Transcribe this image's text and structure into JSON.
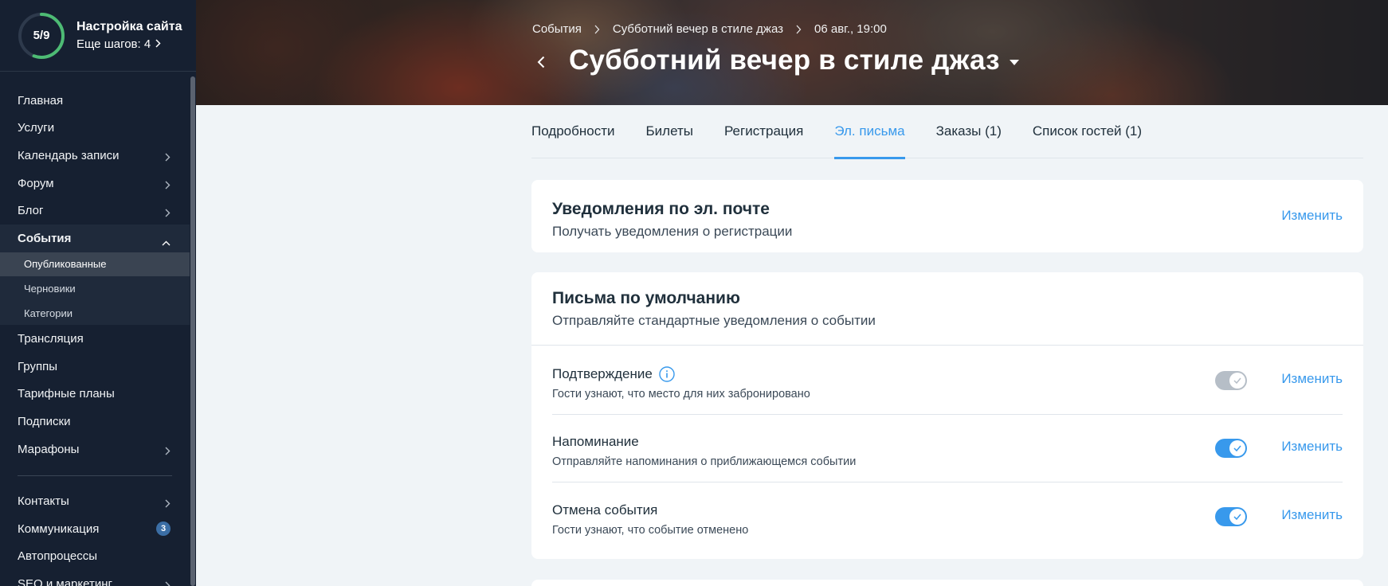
{
  "setup": {
    "progress_text": "5/9",
    "progress": 0.556,
    "title": "Настройка сайта",
    "subtitle": "Еще шагов: 4"
  },
  "sidebar": {
    "items": [
      {
        "label": "Главная"
      },
      {
        "label": "Услуги"
      },
      {
        "label": "Календарь записи"
      },
      {
        "label": "Форум"
      },
      {
        "label": "Блог"
      },
      {
        "label": "События"
      },
      {
        "label": "Трансляция"
      },
      {
        "label": "Группы"
      },
      {
        "label": "Тарифные планы"
      },
      {
        "label": "Подписки"
      },
      {
        "label": "Марафоны"
      },
      {
        "label": "Контакты"
      },
      {
        "label": "Коммуникация",
        "badge": "3"
      },
      {
        "label": "Автопроцессы"
      },
      {
        "label": "SEO и маркетинг"
      }
    ],
    "events_sub": [
      {
        "label": "Опубликованные"
      },
      {
        "label": "Черновики"
      },
      {
        "label": "Категории"
      }
    ]
  },
  "header": {
    "breadcrumbs": [
      "События",
      "Субботний вечер в стиле джаз",
      "06 авг., 19:00"
    ],
    "title": "Субботний вечер в стиле джаз"
  },
  "tabs": [
    "Подробности",
    "Билеты",
    "Регистрация",
    "Эл. письма",
    "Заказы (1)",
    "Список гостей (1)"
  ],
  "active_tab": "Эл. письма",
  "notifications": {
    "title": "Уведомления по эл. почте",
    "subtitle": "Получать уведомления о регистрации",
    "action": "Изменить"
  },
  "defaults": {
    "title": "Письма по умолчанию",
    "subtitle": "Отправляйте стандартные уведомления о событии",
    "rows": [
      {
        "title": "Подтверждение",
        "desc": "Гости узнают, что место для них забронировано",
        "enabled": false,
        "action": "Изменить"
      },
      {
        "title": "Напоминание",
        "desc": "Отправляйте напоминания о приближающемся событии",
        "enabled": true,
        "action": "Изменить"
      },
      {
        "title": "Отмена события",
        "desc": "Гости узнают, что событие отменено",
        "enabled": true,
        "action": "Изменить"
      }
    ]
  },
  "colors": {
    "sidebar_bg": "#162031",
    "accent": "#3899ec",
    "progress_ring": "#4dbb74"
  }
}
